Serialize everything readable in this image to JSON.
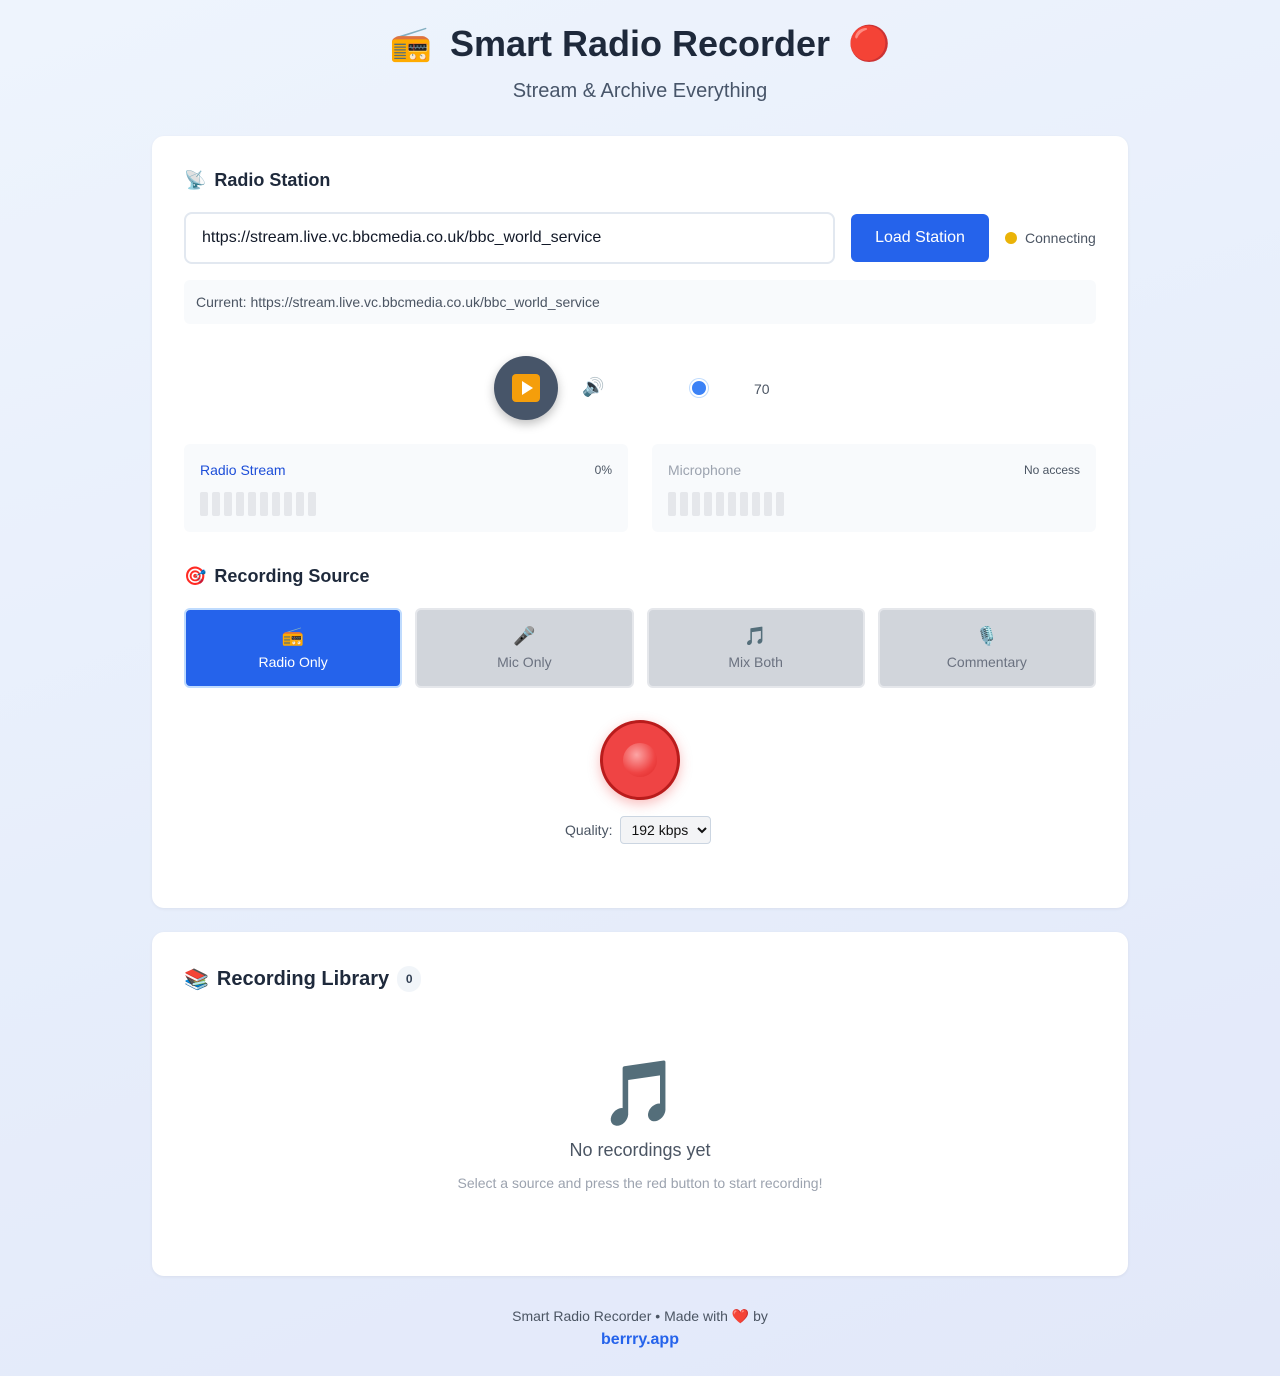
{
  "header": {
    "title": "Smart Radio Recorder",
    "subtitle": "Stream & Archive Everything",
    "left_icon": "📻",
    "right_icon": "🔴"
  },
  "station": {
    "section_title": "Radio Station",
    "section_icon": "📡",
    "url_value": "https://stream.live.vc.bbcmedia.co.uk/bbc_world_service",
    "load_label": "Load Station",
    "status_text": "Connecting",
    "status_color": "#eab308",
    "current_text": "Current: https://stream.live.vc.bbcmedia.co.uk/bbc_world_service"
  },
  "playback": {
    "play_icon": "▶️",
    "speaker_icon": "🔊",
    "volume": "70"
  },
  "meters": {
    "radio": {
      "label": "Radio Stream",
      "value": "0%"
    },
    "mic": {
      "label": "Microphone",
      "value": "No access"
    }
  },
  "source": {
    "section_title": "Recording Source",
    "section_icon": "🎯",
    "options": [
      {
        "icon": "📻",
        "label": "Radio Only",
        "active": true
      },
      {
        "icon": "🎤",
        "label": "Mic Only",
        "active": false
      },
      {
        "icon": "🎵",
        "label": "Mix Both",
        "active": false
      },
      {
        "icon": "🎙️",
        "label": "Commentary",
        "active": false
      }
    ]
  },
  "record": {
    "quality_label": "Quality:",
    "quality_selected": "192 kbps"
  },
  "library": {
    "title": "Recording Library",
    "icon": "📚",
    "count": "0",
    "empty_icon": "🎵",
    "empty_title": "No recordings yet",
    "empty_hint": "Select a source and press the red button to start recording!"
  },
  "footer": {
    "text_before": "Smart Radio Recorder • Made with",
    "heart": "❤️",
    "text_after": "by",
    "link": "berrry.app"
  },
  "colors": {
    "accent": "#2563eb",
    "record": "#ef4444"
  }
}
